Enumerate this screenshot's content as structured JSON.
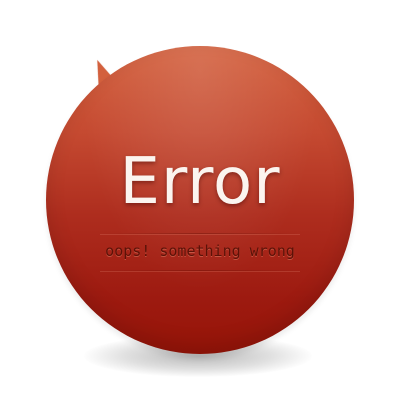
{
  "error": {
    "title": "Error",
    "subtitle": "oops! something wrong"
  },
  "colors": {
    "page_background": "#ffffff",
    "bubble_top": "#d3603d",
    "bubble_bottom": "#961408",
    "title_text": "#fbf4ef",
    "subtitle_text": "#5c1208"
  }
}
